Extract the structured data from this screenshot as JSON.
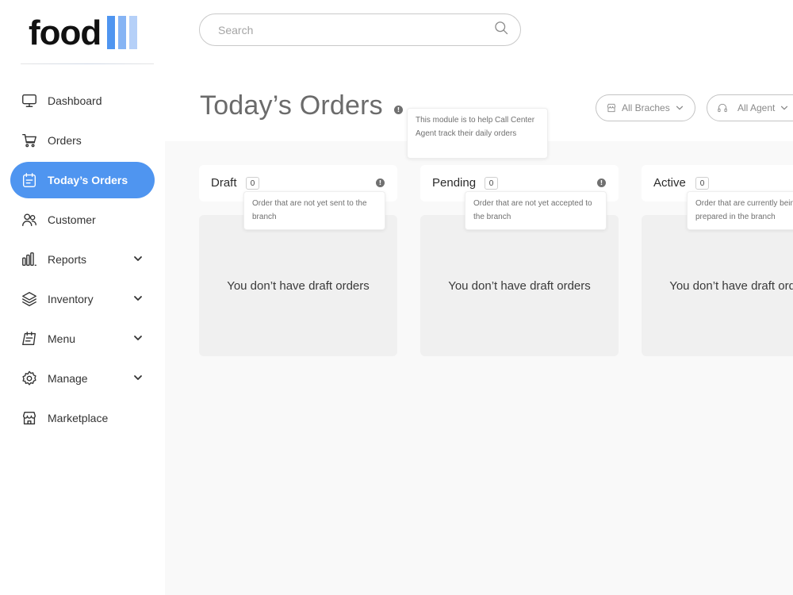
{
  "brand": {
    "logo_text": "food",
    "bar_colors": [
      "#4f95f0",
      "#86b4f4",
      "#b5d0f8"
    ]
  },
  "search": {
    "placeholder": "Search"
  },
  "sidebar": {
    "items": [
      {
        "label": "Dashboard",
        "icon": "monitor-icon",
        "active": false,
        "has_submenu": false
      },
      {
        "label": "Orders",
        "icon": "cart-icon",
        "active": false,
        "has_submenu": false
      },
      {
        "label": "Today’s Orders",
        "icon": "calendar-icon",
        "active": true,
        "has_submenu": false
      },
      {
        "label": "Customer",
        "icon": "users-icon",
        "active": false,
        "has_submenu": false
      },
      {
        "label": "Reports",
        "icon": "bar-chart-icon",
        "active": false,
        "has_submenu": true
      },
      {
        "label": "Inventory",
        "icon": "layers-icon",
        "active": false,
        "has_submenu": true
      },
      {
        "label": "Menu",
        "icon": "menu-book-icon",
        "active": false,
        "has_submenu": true
      },
      {
        "label": "Manage",
        "icon": "gear-icon",
        "active": false,
        "has_submenu": true
      },
      {
        "label": "Marketplace",
        "icon": "store-icon",
        "active": false,
        "has_submenu": false
      }
    ]
  },
  "header": {
    "title": "Today’s Orders",
    "title_tooltip": "This module is to help Call Center Agent track their daily orders",
    "filters": {
      "branches_label": "All Braches",
      "agent_label": "All Agent"
    }
  },
  "columns": [
    {
      "title": "Draft",
      "count": "0",
      "tooltip": "Order that are not yet sent to the branch",
      "empty_text": "You don’t have draft orders"
    },
    {
      "title": "Pending",
      "count": "0",
      "tooltip": "Order that are not yet accepted to the branch",
      "empty_text": "You don’t have draft orders"
    },
    {
      "title": "Active",
      "count": "0",
      "tooltip": "Order that are currently being prepared in the branch",
      "empty_text": "You don’t have draft orders"
    }
  ],
  "colors": {
    "accent": "#4f95f0",
    "board_bg": "#f9f9f9",
    "empty_card_bg": "#f0f0f0"
  }
}
